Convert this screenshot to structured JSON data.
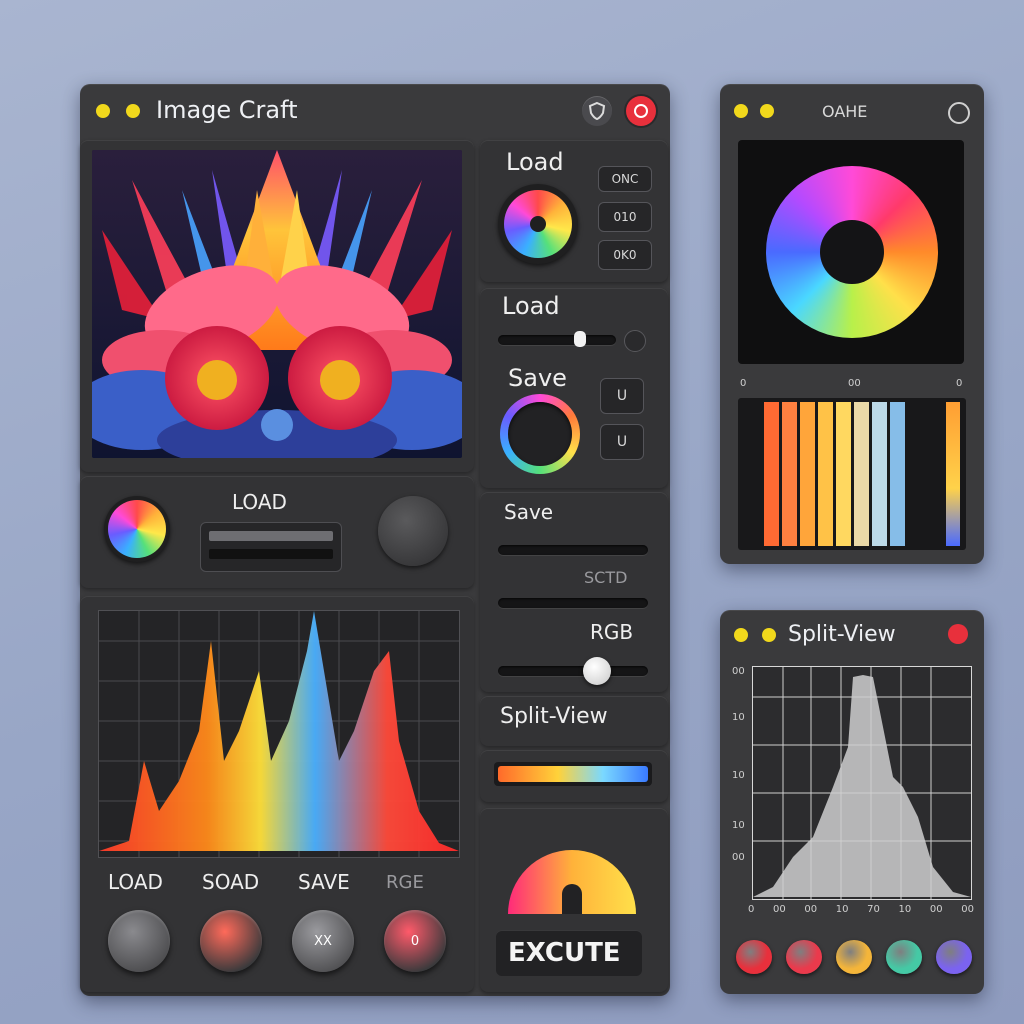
{
  "main_window": {
    "title": "Image Craft",
    "header_icons": [
      "shield-icon",
      "record-icon"
    ]
  },
  "right_column": {
    "load_label_1": "Load",
    "toggle_buttons_1": [
      "ONC",
      "010",
      "0K0"
    ],
    "load_label_2": "Load",
    "save_label": "Save",
    "toggle_buttons_2": [
      "U",
      "U"
    ]
  },
  "middle_bar": {
    "load_label": "LOAD"
  },
  "sliders_panel": {
    "save_label": "Save",
    "sctd_label": "SCTD",
    "rgb_label": "RGB",
    "split_view_label": "Split-View",
    "rgb_slider_value": 0.66
  },
  "execute_panel": {
    "execute_label": "EXCUTE"
  },
  "bottom_buttons": {
    "labels": [
      "LOAD",
      "SOAD",
      "SAVE",
      "RGE"
    ],
    "glyphs": [
      "",
      "",
      "XX",
      "0"
    ]
  },
  "color_window": {
    "title": "OAHE",
    "scale_labels": [
      "0",
      "00",
      "0"
    ],
    "bar_colors": [
      "#ff6a33",
      "#ff8040",
      "#ffa53a",
      "#ffc247",
      "#ffd860",
      "#ead9a8",
      "#bcd9e8",
      "#86bde8",
      "#ff9e33"
    ]
  },
  "split_window": {
    "title": "Split-View",
    "y_ticks": [
      "00",
      "10",
      "10",
      "10",
      "00"
    ],
    "x_ticks": [
      "0",
      "00",
      "00",
      "10",
      "70",
      "10",
      "00",
      "00"
    ],
    "swatches": [
      "#e8303c",
      "#ea3a4c",
      "#f4b53a",
      "#45c9a5",
      "#7b63f0"
    ]
  },
  "colors": {
    "panel": "#3a3a3c",
    "accent_yellow": "#f1d81c",
    "accent_red": "#e8303c"
  }
}
